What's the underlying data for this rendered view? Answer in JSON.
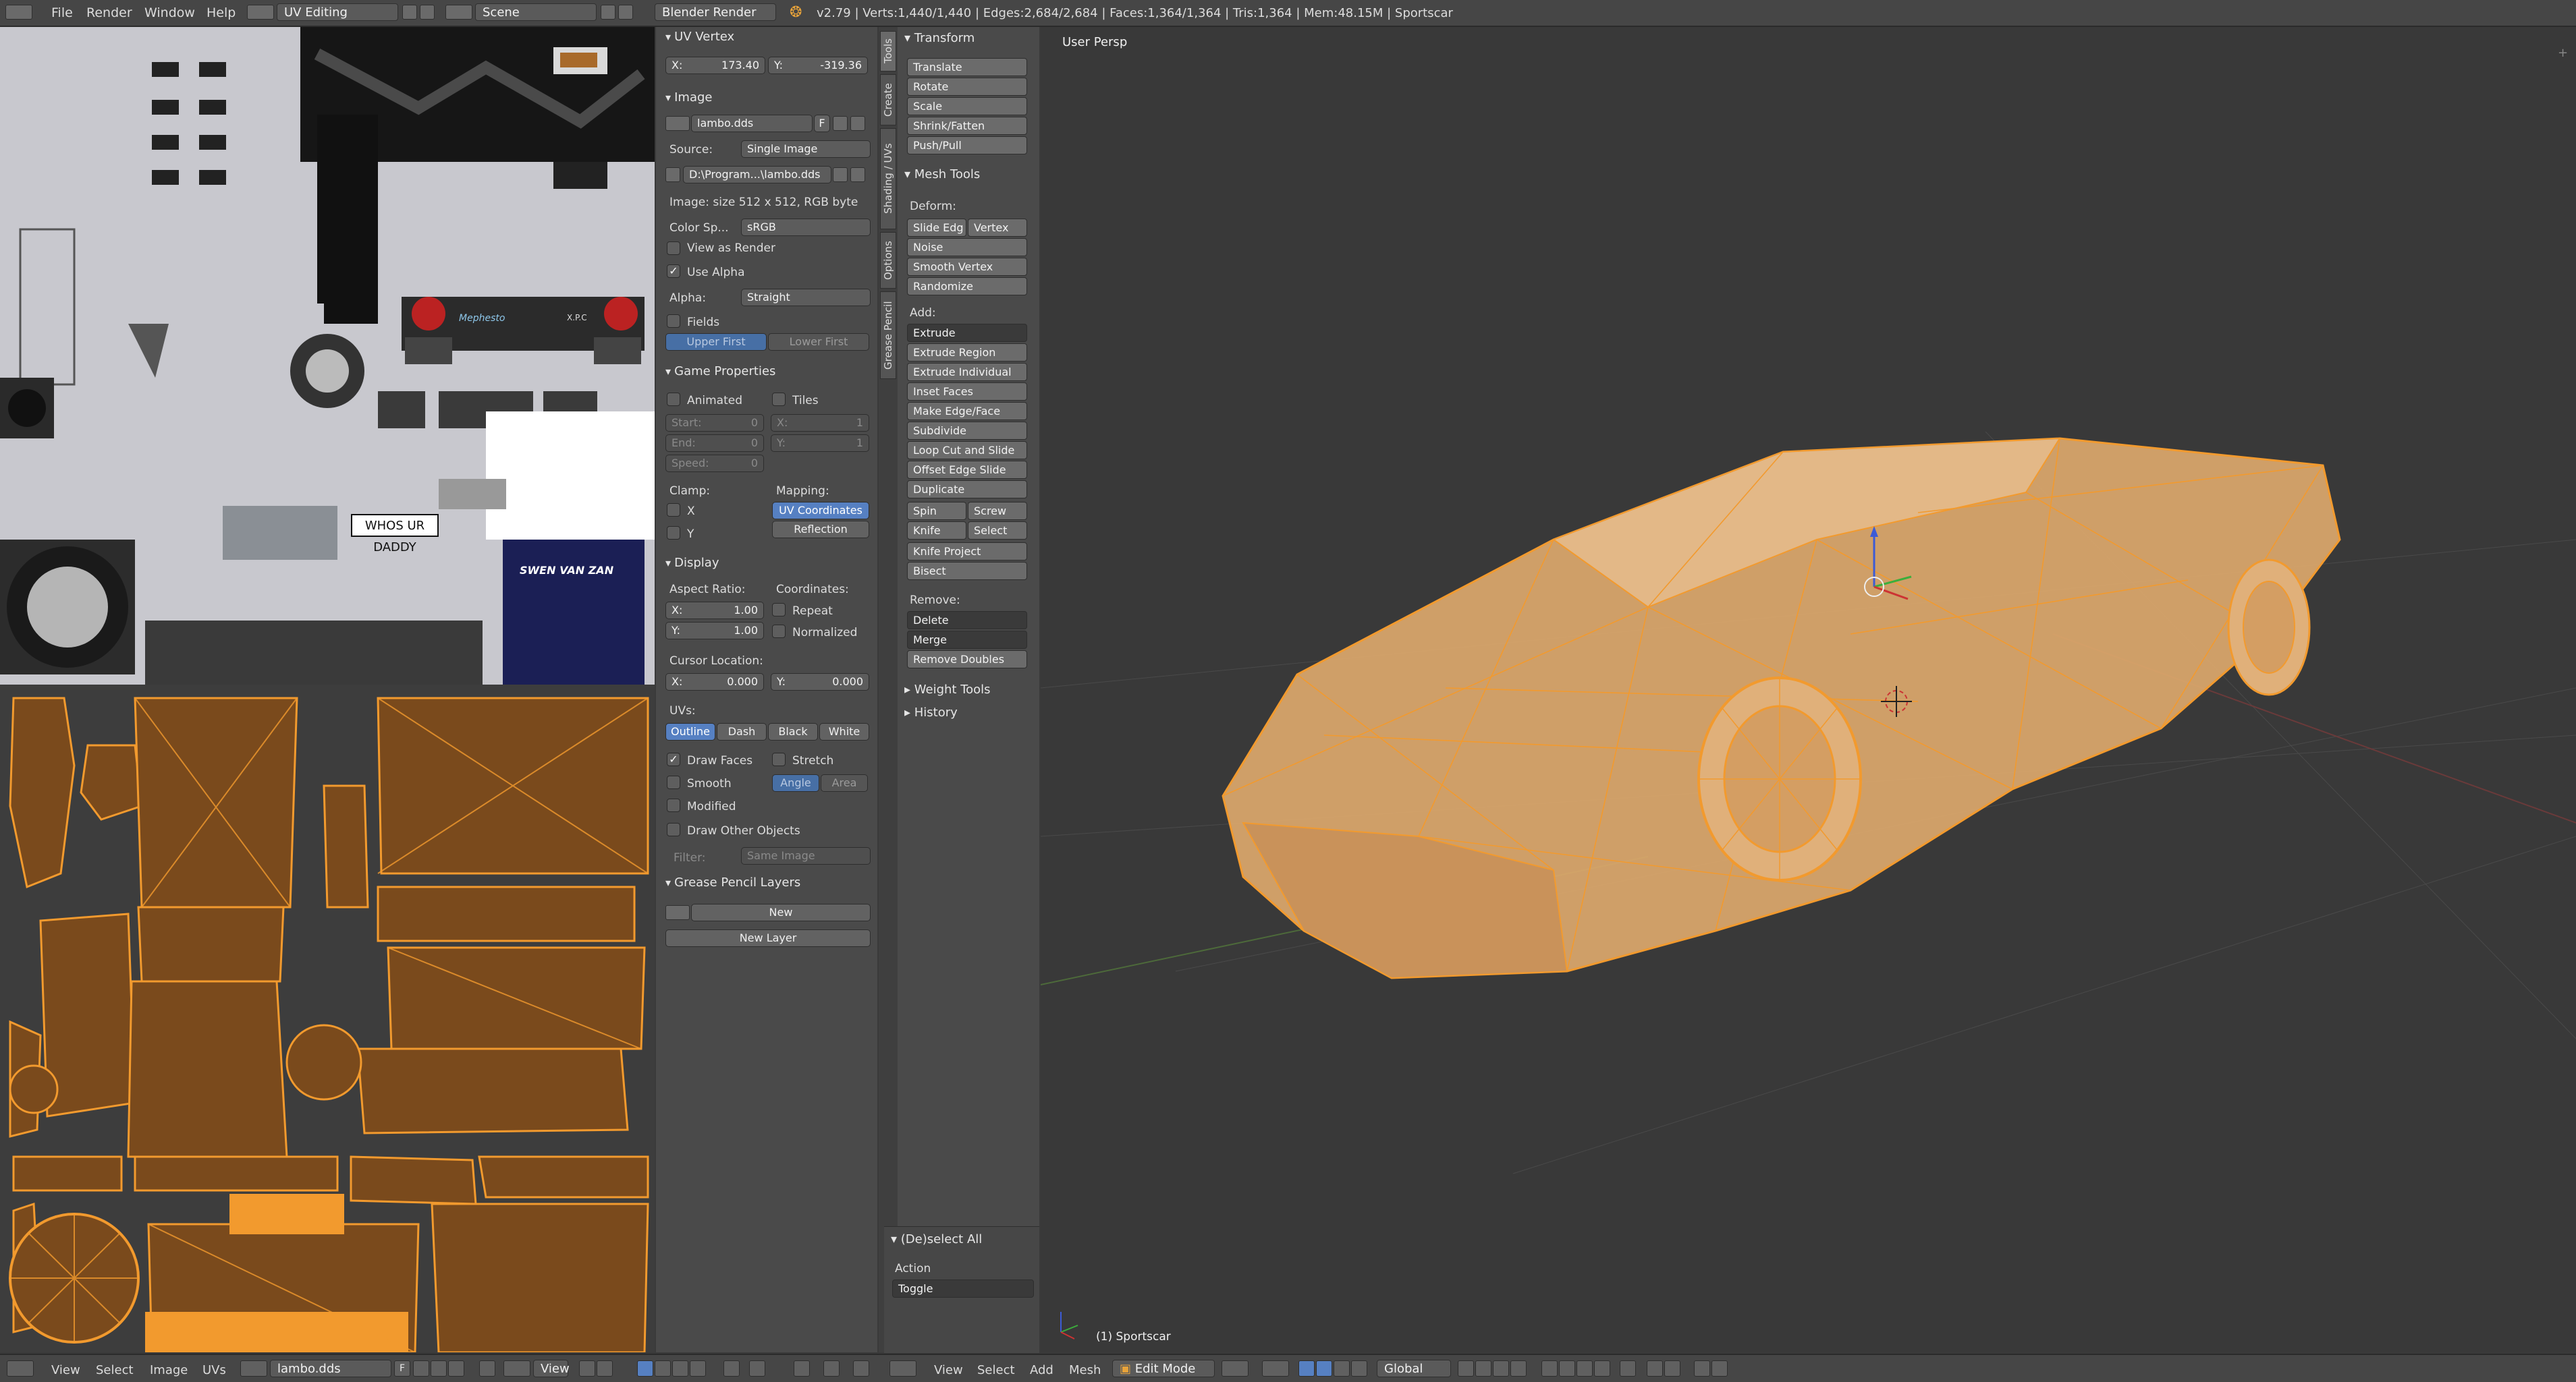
{
  "topbar": {
    "menus": [
      "File",
      "Render",
      "Window",
      "Help"
    ],
    "layout": "UV Editing",
    "scene": "Scene",
    "engine": "Blender Render",
    "stats": "v2.79 | Verts:1,440/1,440 | Edges:2,684/2,684 | Faces:1,364/1,364 | Tris:1,364 | Mem:48.15M | Sportscar"
  },
  "uv_texture": {
    "sticker": "WHOS UR DADDY",
    "banner": "SWEN VAN ZAN",
    "plate": "Mephesto",
    "plate2": "X.P.C"
  },
  "npanel": {
    "uv_vertex": {
      "title": "UV Vertex",
      "x_label": "X:",
      "x": "173.40",
      "y_label": "Y:",
      "y": "-319.36"
    },
    "image": {
      "title": "Image",
      "name": "lambo.dds",
      "fake": "F",
      "source_label": "Source:",
      "source": "Single Image",
      "path": "D:\\Program...\\lambo.dds",
      "info": "Image: size 512 x 512, RGB byte",
      "color_label": "Color Sp...",
      "color": "sRGB",
      "view_as_render": "View as Render",
      "use_alpha": "Use Alpha",
      "alpha_label": "Alpha:",
      "alpha": "Straight",
      "fields": "Fields",
      "upper_first": "Upper First",
      "lower_first": "Lower First"
    },
    "game": {
      "title": "Game Properties",
      "animated": "Animated",
      "tiles": "Tiles",
      "start_label": "Start:",
      "start": "0",
      "end_label": "End:",
      "end": "0",
      "speed_label": "Speed:",
      "speed": "0",
      "tx_label": "X:",
      "tx": "1",
      "ty_label": "Y:",
      "ty": "1",
      "clamp": "Clamp:",
      "mapping": "Mapping:",
      "cx": "X",
      "cy": "Y",
      "uv_coords": "UV Coordinates",
      "reflection": "Reflection"
    },
    "display": {
      "title": "Display",
      "aspect": "Aspect Ratio:",
      "coordinates": "Coordinates:",
      "ax_label": "X:",
      "ax": "1.00",
      "ay_label": "Y:",
      "ay": "1.00",
      "repeat": "Repeat",
      "normalized": "Normalized",
      "cursor": "Cursor Location:",
      "cx_label": "X:",
      "cx": "0.000",
      "cy_label": "Y:",
      "cy": "0.000",
      "uvs": "UVs:",
      "outline": "Outline",
      "dash": "Dash",
      "black": "Black",
      "white": "White",
      "draw_faces": "Draw Faces",
      "stretch": "Stretch",
      "smooth": "Smooth",
      "angle": "Angle",
      "area": "Area",
      "modified": "Modified",
      "draw_other": "Draw Other Objects",
      "filter_label": "Filter:",
      "filter": "Same Image"
    },
    "grease": {
      "title": "Grease Pencil Layers",
      "new": "New",
      "new_layer": "New Layer"
    }
  },
  "tabs": [
    "Tools",
    "Create",
    "Shading / UVs",
    "Options",
    "Grease Pencil"
  ],
  "shelf": {
    "transform": {
      "title": "Transform",
      "items": [
        "Translate",
        "Rotate",
        "Scale",
        "Shrink/Fatten",
        "Push/Pull"
      ]
    },
    "mesh_tools": {
      "title": "Mesh Tools",
      "deform": "Deform:",
      "slide_edge": "Slide Edg",
      "vertex": "Vertex",
      "noise": "Noise",
      "smooth_vertex": "Smooth Vertex",
      "randomize": "Randomize",
      "add": "Add:",
      "extrude": "Extrude",
      "add_items": [
        "Extrude Region",
        "Extrude Individual",
        "Inset Faces",
        "Make Edge/Face",
        "Subdivide",
        "Loop Cut and Slide",
        "Offset Edge Slide",
        "Duplicate"
      ],
      "spin": "Spin",
      "screw": "Screw",
      "knife": "Knife",
      "select": "Select",
      "knife_project": "Knife Project",
      "bisect": "Bisect",
      "remove": "Remove:",
      "delete": "Delete",
      "merge": "Merge",
      "remove_doubles": "Remove Doubles"
    },
    "weight_tools": "Weight Tools",
    "history": "History",
    "operator": {
      "title": "(De)select All",
      "action_label": "Action",
      "action": "Toggle"
    }
  },
  "viewport": {
    "title": "User Persp",
    "object": "(1) Sportscar"
  },
  "bottombar": {
    "uv_menus": [
      "View",
      "Select",
      "Image",
      "UVs"
    ],
    "image_name": "lambo.dds",
    "fake": "F",
    "view_dd": "View",
    "v3d_menus": [
      "View",
      "Select",
      "Add",
      "Mesh"
    ],
    "mode": "Edit Mode",
    "orientation": "Global"
  },
  "colors": {
    "accent": "#5680c2",
    "wire": "#f29a2e",
    "mesh_fill": "#dba76a"
  }
}
